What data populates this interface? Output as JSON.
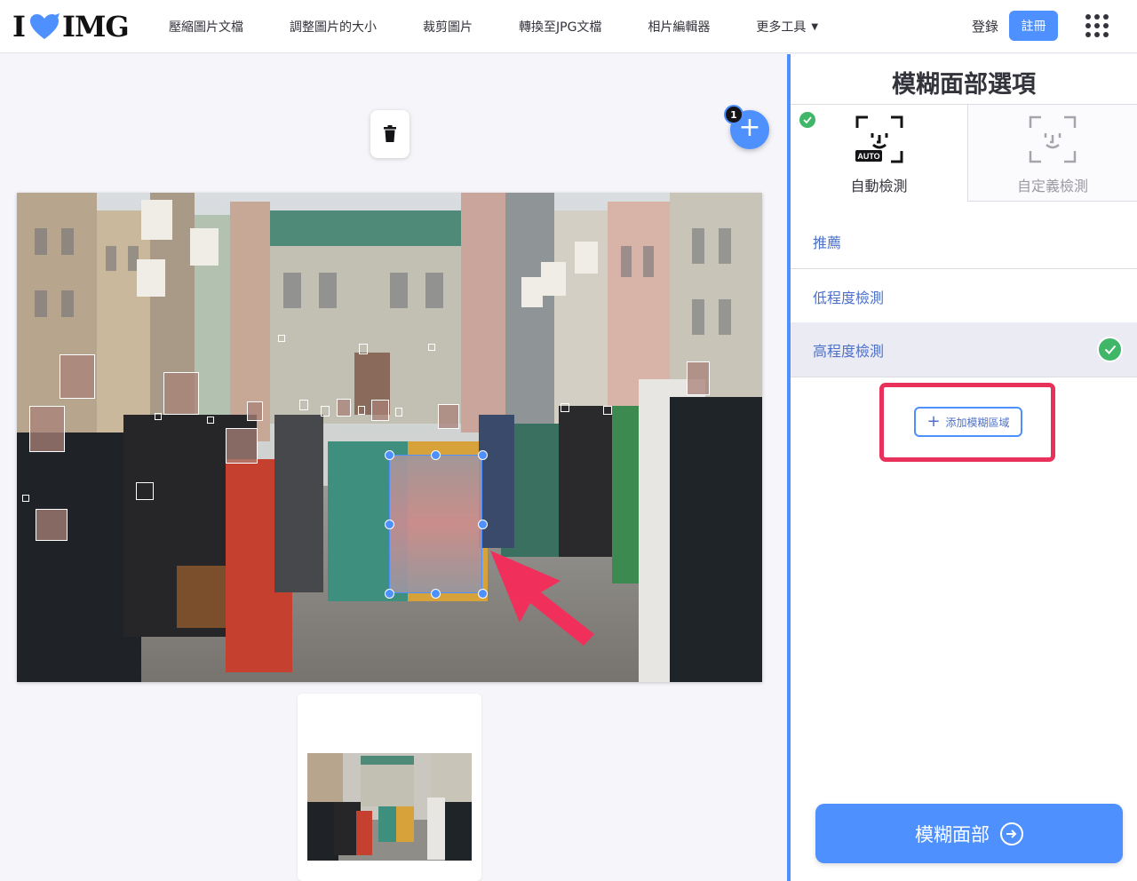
{
  "header": {
    "logo": {
      "left": "I",
      "right": "IMG",
      "icon": "heart-icon",
      "color": "#4d90fe"
    },
    "nav": [
      {
        "label": "壓縮圖片文檔"
      },
      {
        "label": "調整圖片的大小"
      },
      {
        "label": "裁剪圖片"
      },
      {
        "label": "轉換至JPG文檔"
      },
      {
        "label": "相片編輯器"
      },
      {
        "label": "更多工具",
        "caret": "▼"
      }
    ],
    "login_label": "登錄",
    "signup_label": "註冊"
  },
  "workspace": {
    "add_count": "1",
    "add_symbol": "+"
  },
  "sidebar": {
    "title": "模糊面部選項",
    "modes": [
      {
        "label": "自動檢測",
        "badge": "AUTO",
        "selected": true
      },
      {
        "label": "自定義檢測",
        "selected": false
      }
    ],
    "options": [
      {
        "label": "推薦",
        "selected": false
      },
      {
        "label": "低程度檢測",
        "selected": false
      },
      {
        "label": "高程度檢測",
        "selected": true
      }
    ],
    "add_blur_label": "添加模糊區域",
    "blur_button_label": "模糊面部",
    "accent_color": "#4d90fe",
    "check_color": "#3fb668",
    "highlight_color": "#e8315b"
  }
}
